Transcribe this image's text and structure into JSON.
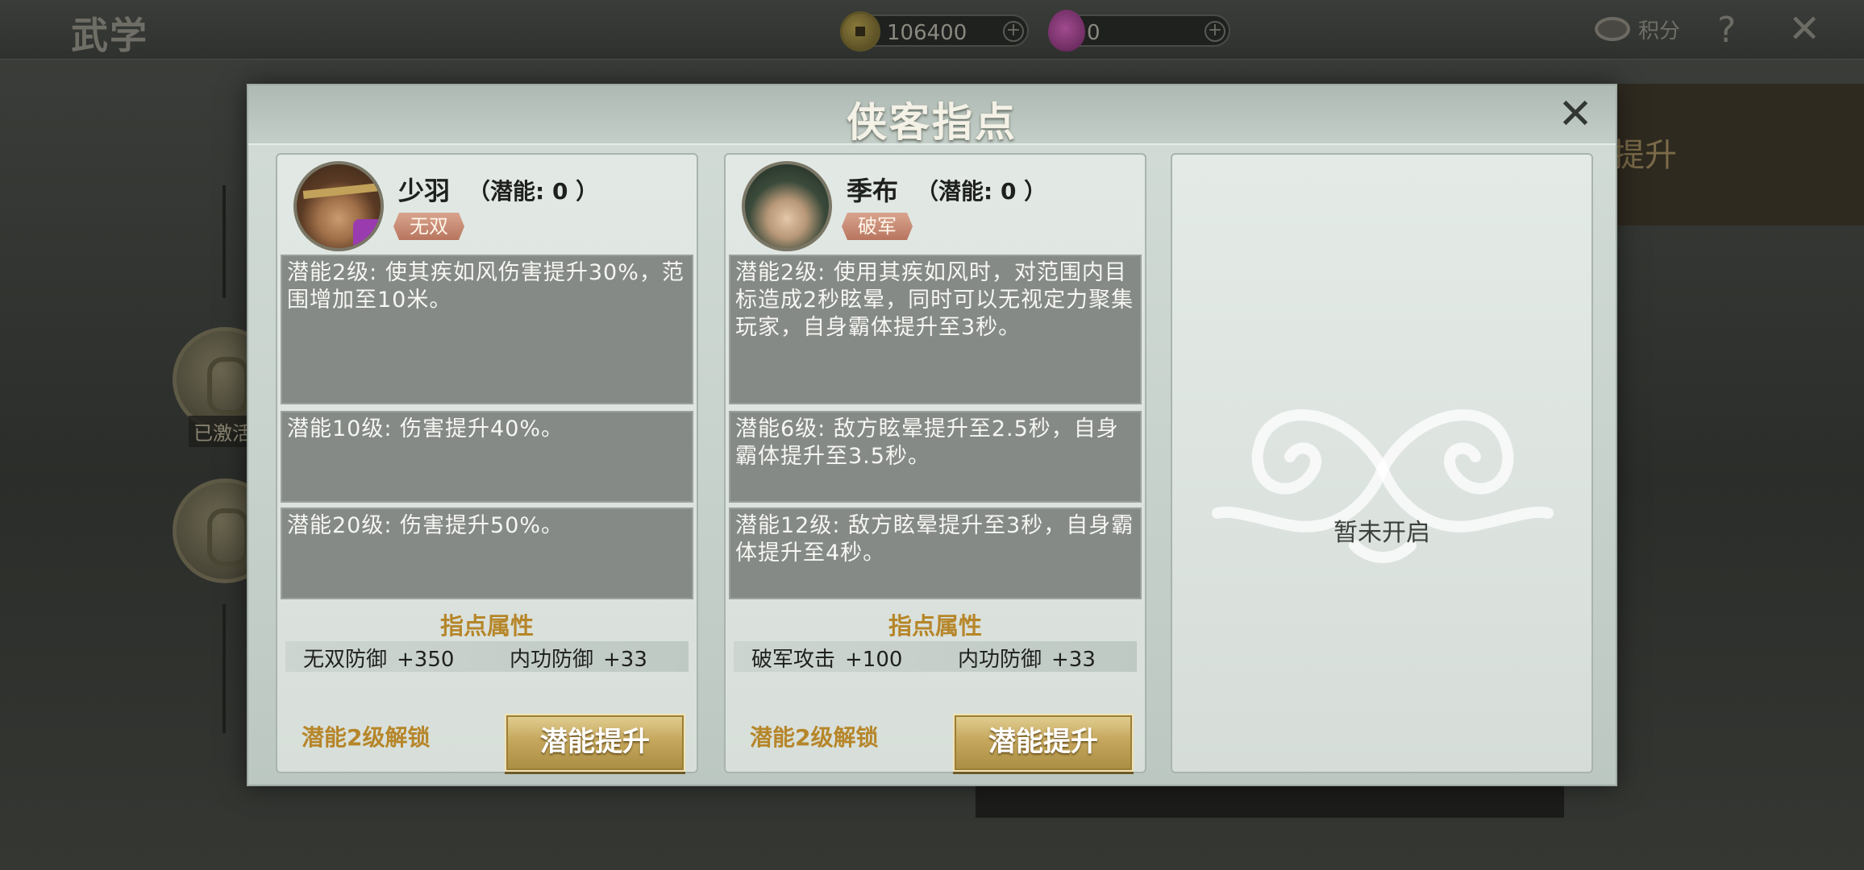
{
  "page": {
    "title": "武学"
  },
  "topbar": {
    "coins": "106400",
    "gems": "0",
    "score_label": "积分",
    "plus": "+",
    "help": "?",
    "exit": "✕"
  },
  "background": {
    "panel_text": "提升",
    "activated_label": "已激活"
  },
  "modal": {
    "title": "侠客指点",
    "close": "✕",
    "attr_title": "指点属性",
    "locked_text": "暂未开启"
  },
  "heroes": [
    {
      "name": "少羽",
      "potential": "（潜能: 0 ）",
      "tag": "无双",
      "tag_color": "#c48c76",
      "descriptions": [
        "潜能2级: 使其疾如风伤害提升30%，范围增加至10米。",
        "潜能10级: 伤害提升40%。",
        "潜能20级: 伤害提升50%。"
      ],
      "attributes": [
        {
          "name": "无双防御",
          "value": "+350"
        },
        {
          "name": "内功防御",
          "value": "+33"
        }
      ],
      "unlock_text": "潜能2级解锁",
      "upgrade_label": "潜能提升"
    },
    {
      "name": "季布",
      "potential": "（潜能: 0 ）",
      "tag": "破军",
      "tag_color": "#c48c76",
      "descriptions": [
        "潜能2级: 使用其疾如风时，对范围内目标造成2秒眩晕，同时可以无视定力聚集玩家，自身霸体提升至3秒。",
        "潜能6级: 敌方眩晕提升至2.5秒，自身霸体提升至3.5秒。",
        "潜能12级: 敌方眩晕提升至3秒，自身霸体提升至4秒。"
      ],
      "attributes": [
        {
          "name": "破军攻击",
          "value": "+100"
        },
        {
          "name": "内功防御",
          "value": "+33"
        }
      ],
      "unlock_text": "潜能2级解锁",
      "upgrade_label": "潜能提升"
    }
  ],
  "colors": {
    "accent_gold": "#b6862a",
    "button_gold": "#c5a75d",
    "panel_bg": "#c9d3cd",
    "desc_bg": "#858a86"
  }
}
